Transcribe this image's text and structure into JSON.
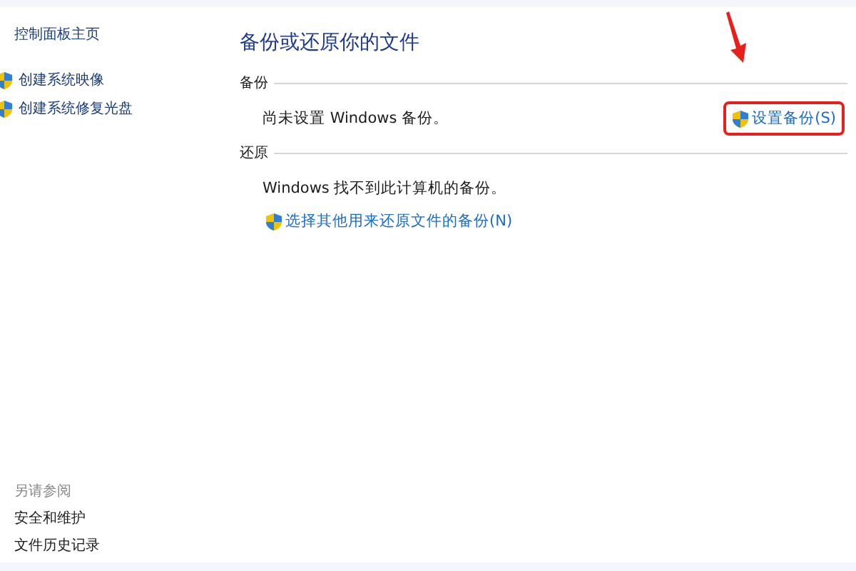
{
  "sidebar": {
    "home_link": "控制面板主页",
    "items": [
      {
        "label": "创建系统映像"
      },
      {
        "label": "创建系统修复光盘"
      }
    ],
    "see_also": {
      "heading": "另请参阅",
      "links": [
        "安全和维护",
        "文件历史记录"
      ]
    }
  },
  "main": {
    "title": "备份或还原你的文件",
    "sections": [
      {
        "heading": "备份",
        "message": "尚未设置 Windows 备份。",
        "link": "设置备份(S)",
        "kind": "inline",
        "highlighted": true
      },
      {
        "heading": "还原",
        "message": "Windows 找不到此计算机的备份。",
        "link": "选择其他用来还原文件的备份(N)",
        "kind": "block",
        "highlighted": false
      }
    ]
  }
}
